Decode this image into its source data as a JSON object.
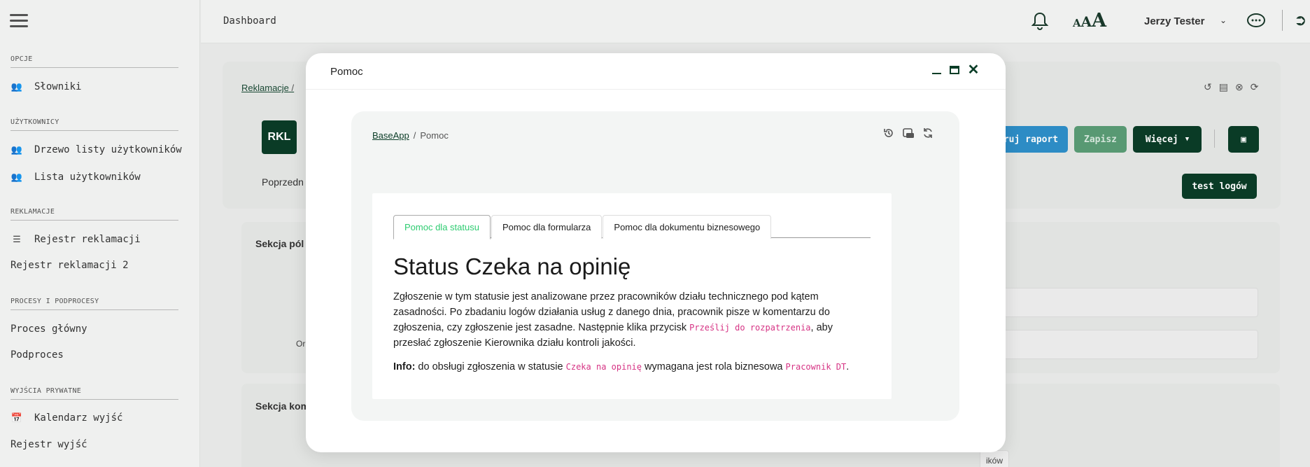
{
  "topbar": {
    "title": "Dashboard",
    "user_name": "Jerzy Tester",
    "font_size_label": "AAA"
  },
  "sidebar": {
    "sections": [
      {
        "label": "OPCJE",
        "items": [
          {
            "label": "Słowniki",
            "icon": "users-icon"
          }
        ]
      },
      {
        "label": "UŻYTKOWNICY",
        "items": [
          {
            "label": "Drzewo listy użytkowników",
            "icon": "users-icon"
          },
          {
            "label": "Lista użytkowników",
            "icon": "users-icon"
          }
        ]
      },
      {
        "label": "REKLAMACJE",
        "items": [
          {
            "label": "Rejestr reklamacji",
            "icon": "list-icon"
          },
          {
            "label": "Rejestr reklamacji 2",
            "icon": ""
          }
        ]
      },
      {
        "label": "PROCESY I PODPROCESY",
        "items": [
          {
            "label": "Proces główny",
            "icon": ""
          },
          {
            "label": "Podproces",
            "icon": ""
          }
        ]
      },
      {
        "label": "WYJŚCIA PRYWATNE",
        "items": [
          {
            "label": "Kalendarz wyjść",
            "icon": "calendar-icon"
          },
          {
            "label": "Rejestr wyjść",
            "icon": ""
          }
        ]
      }
    ]
  },
  "background": {
    "breadcrumb": "Reklamacje",
    "breadcrumb_sep": "/",
    "badge": "RKL",
    "prev_label": "Poprzedn",
    "report_button": "ruj raport",
    "save_button": "Zapisz",
    "more_button": "Więcej",
    "logs_button": "test logów",
    "section1": "Sekcja pól",
    "section2": "Sekcja kom",
    "field_label": "Or",
    "bottom_label": "ików"
  },
  "modal": {
    "title": "Pomoc",
    "breadcrumb": {
      "root": "BaseApp",
      "separator": "/",
      "current": "Pomoc"
    },
    "tabs": [
      {
        "label": "Pomoc dla statusu",
        "active": true
      },
      {
        "label": "Pomoc dla formularza",
        "active": false
      },
      {
        "label": "Pomoc dla dokumentu biznesowego",
        "active": false
      }
    ],
    "heading": "Status Czeka na opinię",
    "description_before": "Zgłoszenie w tym statusie jest analizowane przez pracowników działu technicznego pod kątem zasadności. Po zbadaniu logów działania usług z danego dnia, pracownik pisze w komentarzu do zgłoszenia, czy zgłoszenie jest zasadne. Następnie klika przycisk ",
    "description_code": "Prześlij do rozpatrzenia",
    "description_after": ", aby przesłać zgłoszenie Kierownika działu kontroli jakości.",
    "info_label": "Info:",
    "info_before": " do obsługi zgłoszenia w statusie ",
    "info_status": "Czeka na opinię",
    "info_middle": " wymagana jest rola biznesowa ",
    "info_role": "Pracownik DT",
    "info_end": "."
  },
  "colors": {
    "brand": "#0b3d27",
    "active_tab": "#2ecc71",
    "code": "#d63384"
  }
}
